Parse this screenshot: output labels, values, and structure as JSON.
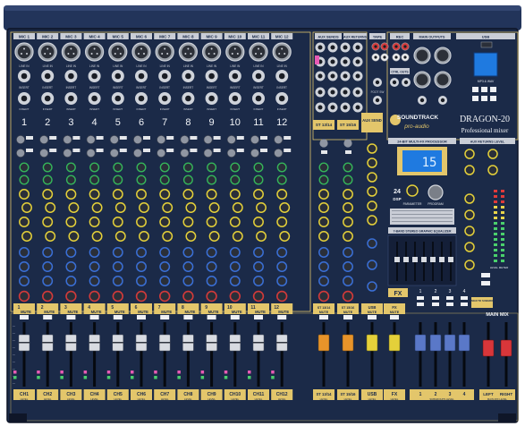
{
  "brand": {
    "logo_text": "SOUNDTRACK",
    "logo_sub": "pro-audio",
    "model": "DRAGON-20",
    "tagline": "Professional mixer"
  },
  "mic_channels": [
    {
      "header": "MIC 1",
      "number": "1",
      "mute": "MUTE",
      "strip": "CH1"
    },
    {
      "header": "MIC 2",
      "number": "2",
      "mute": "MUTE",
      "strip": "CH2"
    },
    {
      "header": "MIC 3",
      "number": "3",
      "mute": "MUTE",
      "strip": "CH3"
    },
    {
      "header": "MIC 4",
      "number": "4",
      "mute": "MUTE",
      "strip": "CH4"
    },
    {
      "header": "MIC 5",
      "number": "5",
      "mute": "MUTE",
      "strip": "CH5"
    },
    {
      "header": "MIC 6",
      "number": "6",
      "mute": "MUTE",
      "strip": "CH6"
    },
    {
      "header": "MIC 7",
      "number": "7",
      "mute": "MUTE",
      "strip": "CH7"
    },
    {
      "header": "MIC 8",
      "number": "8",
      "mute": "MUTE",
      "strip": "CH8"
    },
    {
      "header": "MIC 9",
      "number": "9",
      "mute": "MUTE",
      "strip": "CH9"
    },
    {
      "header": "MIC 10",
      "number": "10",
      "mute": "MUTE",
      "strip": "CH10"
    },
    {
      "header": "MIC 11",
      "number": "11",
      "mute": "MUTE",
      "strip": "CH11"
    },
    {
      "header": "MIC 12",
      "number": "12",
      "mute": "MUTE",
      "strip": "CH12"
    }
  ],
  "labels": {
    "line_in": "LINE IN",
    "insert": "INSERT",
    "level": "LEVEL",
    "aux_sends": "AUX SENDS",
    "aux_returns": "AUX RETURNS",
    "tape": "TAPE",
    "rec": "REC",
    "main_outputs": "MAIN OUTPUTS",
    "usb": "USB",
    "ctrl_outs": "CTRL OUTS",
    "foot_sw": "FOOT SW",
    "mp3_wav": "MP3 & WAV",
    "aux_send": "AUX SEND",
    "processor": "24-BIT MULTI-FX PROCESSOR",
    "parameter": "PARAMETER",
    "program": "PROGRAM",
    "fx_display": "15",
    "fx_count": "24",
    "fx_word": "DSP",
    "geq": "7-BAND STEREO GRAPHIC EQUALIZER",
    "aux_returns_level": "AUX RETURNS LEVEL",
    "fx": "FX",
    "main_mix": "MAIN MIX",
    "assign_to_subgroup": "ASSIGN TO SUBGROUP",
    "subgroups_level": "SUBGROUPS LEVEL",
    "main_mix_level": "MAIN MIX LEVEL",
    "usb_section": "USB",
    "level_meter": "LEVEL METER"
  },
  "stereo_channels": [
    {
      "top": "ST 13/14",
      "mute": "MUTE",
      "strip": "ST 13/14"
    },
    {
      "top": "ST 15/16",
      "mute": "MUTE",
      "strip": "ST 15/16"
    }
  ],
  "extra_strips": [
    {
      "mute": "MUTE",
      "strip": "USB"
    },
    {
      "mute": "MUTE",
      "strip": "FX"
    }
  ],
  "subgroups": {
    "numbers": [
      "1",
      "2",
      "3",
      "4"
    ],
    "strips": [
      "1",
      "2",
      "3",
      "4"
    ]
  },
  "main_strip": {
    "left": "LEFT",
    "right": "RIGHT"
  },
  "colors": {
    "panel": "#1b2a48",
    "panel_dark": "#141f38",
    "accent": "#e3c66b",
    "knob_yellow": "#e4d03a",
    "knob_blue": "#3a6fd6",
    "knob_red": "#d23a3a",
    "knob_green": "#35b55a",
    "lcd_blue": "#1f7ae0"
  }
}
